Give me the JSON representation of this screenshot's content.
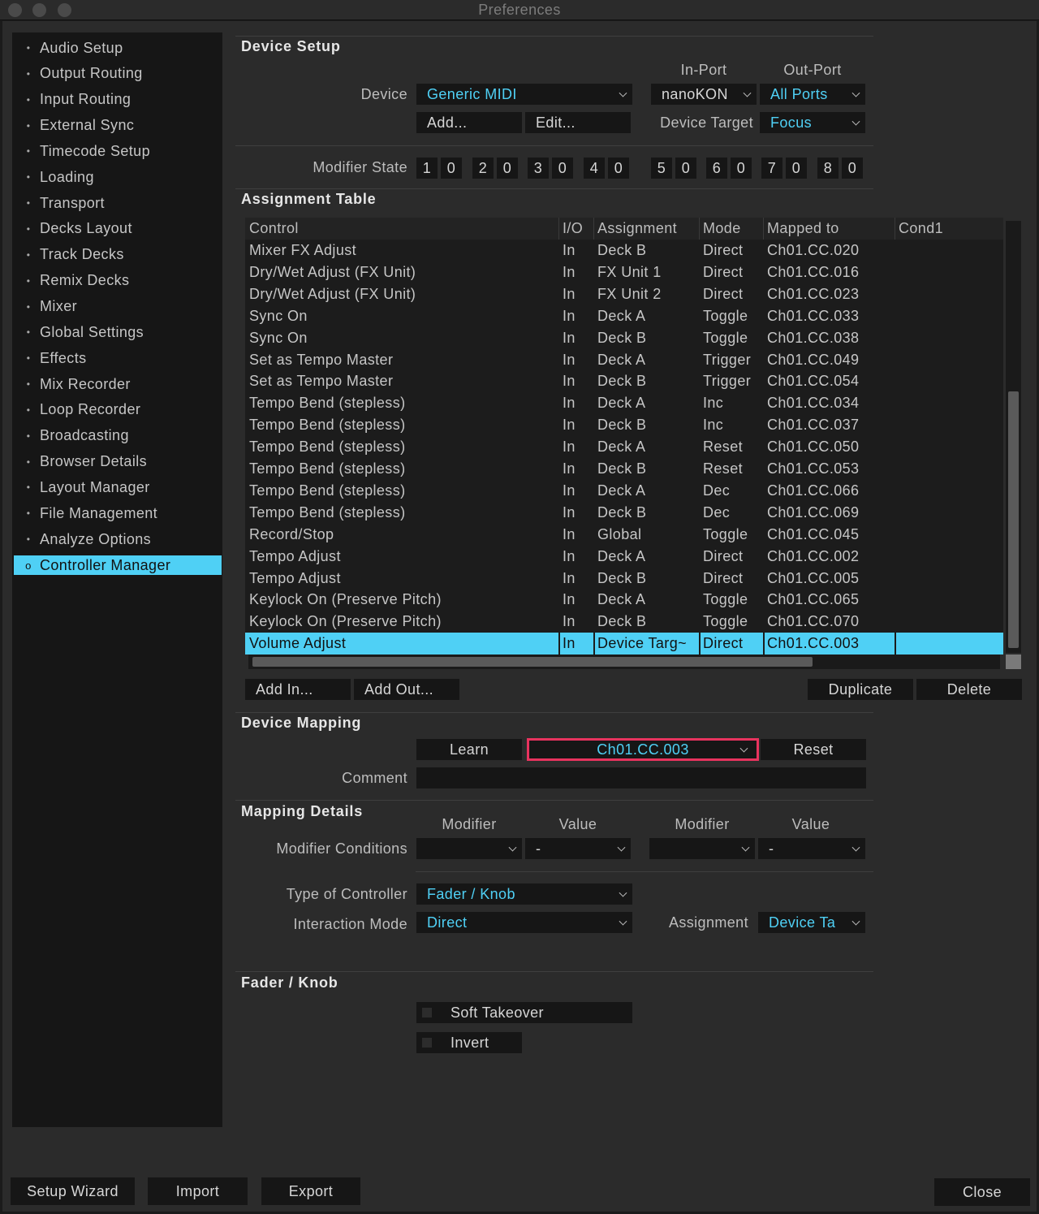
{
  "window": {
    "title": "Preferences"
  },
  "sidebar": {
    "items": [
      {
        "label": "Audio Setup"
      },
      {
        "label": "Output Routing"
      },
      {
        "label": "Input Routing"
      },
      {
        "label": "External Sync"
      },
      {
        "label": "Timecode Setup"
      },
      {
        "label": "Loading"
      },
      {
        "label": "Transport"
      },
      {
        "label": "Decks Layout"
      },
      {
        "label": "Track Decks"
      },
      {
        "label": "Remix Decks"
      },
      {
        "label": "Mixer"
      },
      {
        "label": "Global Settings"
      },
      {
        "label": "Effects"
      },
      {
        "label": "Mix Recorder"
      },
      {
        "label": "Loop Recorder"
      },
      {
        "label": "Broadcasting"
      },
      {
        "label": "Browser Details"
      },
      {
        "label": "Layout Manager"
      },
      {
        "label": "File Management"
      },
      {
        "label": "Analyze Options"
      },
      {
        "label": "Controller Manager",
        "active": true
      }
    ],
    "bullet": "•",
    "active_bullet": "o"
  },
  "device_setup": {
    "title": "Device Setup",
    "in_port_label": "In-Port",
    "out_port_label": "Out-Port",
    "device_label": "Device",
    "device_value": "Generic MIDI",
    "in_port_value": "nanoKON",
    "out_port_value": "All Ports",
    "add_button": "Add...",
    "edit_button": "Edit...",
    "device_target_label": "Device Target",
    "device_target_value": "Focus",
    "modifier_state_label": "Modifier State",
    "modifiers": [
      {
        "num": "1",
        "val": "0"
      },
      {
        "num": "2",
        "val": "0"
      },
      {
        "num": "3",
        "val": "0"
      },
      {
        "num": "4",
        "val": "0"
      },
      {
        "num": "5",
        "val": "0"
      },
      {
        "num": "6",
        "val": "0"
      },
      {
        "num": "7",
        "val": "0"
      },
      {
        "num": "8",
        "val": "0"
      }
    ]
  },
  "assignment_table": {
    "title": "Assignment Table",
    "columns": [
      "Control",
      "I/O",
      "Assignment",
      "Mode",
      "Mapped to",
      "Cond1"
    ],
    "rows": [
      [
        "Mixer FX Adjust",
        "In",
        "Deck B",
        "Direct",
        "Ch01.CC.020"
      ],
      [
        "Dry/Wet Adjust (FX Unit)",
        "In",
        "FX Unit 1",
        "Direct",
        "Ch01.CC.016"
      ],
      [
        "Dry/Wet Adjust (FX Unit)",
        "In",
        "FX Unit 2",
        "Direct",
        "Ch01.CC.023"
      ],
      [
        "Sync On",
        "In",
        "Deck A",
        "Toggle",
        "Ch01.CC.033"
      ],
      [
        "Sync On",
        "In",
        "Deck B",
        "Toggle",
        "Ch01.CC.038"
      ],
      [
        "Set as Tempo Master",
        "In",
        "Deck A",
        "Trigger",
        "Ch01.CC.049"
      ],
      [
        "Set as Tempo Master",
        "In",
        "Deck B",
        "Trigger",
        "Ch01.CC.054"
      ],
      [
        "Tempo Bend (stepless)",
        "In",
        "Deck A",
        "Inc",
        "Ch01.CC.034"
      ],
      [
        "Tempo Bend (stepless)",
        "In",
        "Deck B",
        "Inc",
        "Ch01.CC.037"
      ],
      [
        "Tempo Bend (stepless)",
        "In",
        "Deck A",
        "Reset",
        "Ch01.CC.050"
      ],
      [
        "Tempo Bend (stepless)",
        "In",
        "Deck B",
        "Reset",
        "Ch01.CC.053"
      ],
      [
        "Tempo Bend (stepless)",
        "In",
        "Deck A",
        "Dec",
        "Ch01.CC.066"
      ],
      [
        "Tempo Bend (stepless)",
        "In",
        "Deck B",
        "Dec",
        "Ch01.CC.069"
      ],
      [
        "Record/Stop",
        "In",
        "Global",
        "Toggle",
        "Ch01.CC.045"
      ],
      [
        "Tempo Adjust",
        "In",
        "Deck A",
        "Direct",
        "Ch01.CC.002"
      ],
      [
        "Tempo Adjust",
        "In",
        "Deck B",
        "Direct",
        "Ch01.CC.005"
      ],
      [
        "Keylock On (Preserve Pitch)",
        "In",
        "Deck A",
        "Toggle",
        "Ch01.CC.065"
      ],
      [
        "Keylock On (Preserve Pitch)",
        "In",
        "Deck B",
        "Toggle",
        "Ch01.CC.070"
      ],
      [
        "Volume Adjust",
        "In",
        "Device Targ~",
        "Direct",
        "Ch01.CC.003"
      ]
    ],
    "selected_row": 18,
    "add_in_button": "Add In...",
    "add_out_button": "Add Out...",
    "duplicate_button": "Duplicate",
    "delete_button": "Delete"
  },
  "device_mapping": {
    "title": "Device Mapping",
    "learn_button": "Learn",
    "mapped_value": "Ch01.CC.003",
    "reset_button": "Reset",
    "comment_label": "Comment",
    "comment_value": ""
  },
  "mapping_details": {
    "title": "Mapping Details",
    "modifier_label_1": "Modifier",
    "value_label_1": "Value",
    "modifier_label_2": "Modifier",
    "value_label_2": "Value",
    "modifier_conditions_label": "Modifier Conditions",
    "cond1_modifier": "",
    "cond1_value": "-",
    "cond2_modifier": "",
    "cond2_value": "-",
    "type_of_controller_label": "Type of Controller",
    "type_of_controller_value": "Fader / Knob",
    "interaction_mode_label": "Interaction Mode",
    "interaction_mode_value": "Direct",
    "assignment_label": "Assignment",
    "assignment_value": "Device Ta"
  },
  "fader_knob": {
    "title": "Fader / Knob",
    "soft_takeover_label": "Soft Takeover",
    "invert_label": "Invert"
  },
  "footer": {
    "setup_wizard_button": "Setup Wizard",
    "import_button": "Import",
    "export_button": "Export",
    "close_button": "Close"
  },
  "colors": {
    "accent": "#4fd0f5",
    "highlight_border": "#e8335e",
    "background": "#2b2b2b",
    "control_bg": "#161616"
  }
}
